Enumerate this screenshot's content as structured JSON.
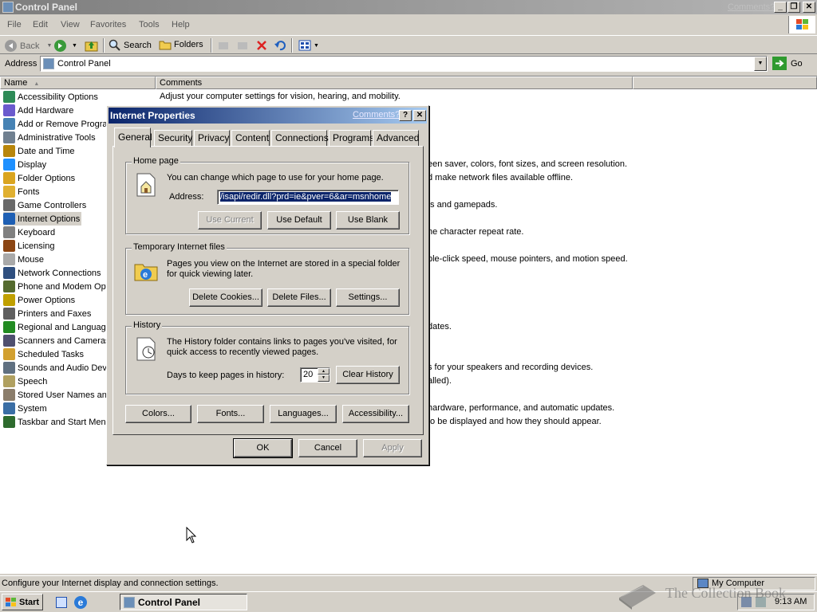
{
  "window": {
    "title": "Control Panel",
    "comments_link": "Comments?"
  },
  "menu": [
    "File",
    "Edit",
    "View",
    "Favorites",
    "Tools",
    "Help"
  ],
  "toolbar": {
    "back": "Back",
    "search": "Search",
    "folders": "Folders"
  },
  "address": {
    "label": "Address",
    "value": "Control Panel",
    "go": "Go"
  },
  "columns": {
    "name": "Name",
    "comments": "Comments"
  },
  "items": [
    {
      "name": "Accessibility Options",
      "comment": "Adjust your computer settings for vision, hearing, and mobility.",
      "color": "#2e8b57"
    },
    {
      "name": "Add Hardware",
      "comment": "",
      "color": "#6a5acd"
    },
    {
      "name": "Add or Remove Progra",
      "comment": "",
      "color": "#4682b4"
    },
    {
      "name": "Administrative Tools",
      "comment": "",
      "color": "#708090"
    },
    {
      "name": "Date and Time",
      "comment": "",
      "color": "#b8860b"
    },
    {
      "name": "Display",
      "comment": "een saver, colors, font sizes, and screen resolution.",
      "color": "#1e90ff"
    },
    {
      "name": "Folder Options",
      "comment": "d make network files available offline.",
      "color": "#daa520"
    },
    {
      "name": "Fonts",
      "comment": "",
      "color": "#e0b030"
    },
    {
      "name": "Game Controllers",
      "comment": "ts and gamepads.",
      "color": "#696969"
    },
    {
      "name": "Internet Options",
      "comment": "",
      "color": "#1e5fb4"
    },
    {
      "name": "Keyboard",
      "comment": "he character repeat rate.",
      "color": "#808080"
    },
    {
      "name": "Licensing",
      "comment": "",
      "color": "#8b4513"
    },
    {
      "name": "Mouse",
      "comment": "ble-click speed, mouse pointers, and motion speed.",
      "color": "#a9a9a9"
    },
    {
      "name": "Network Connections",
      "comment": "",
      "color": "#2f4f7f"
    },
    {
      "name": "Phone and Modem Opt",
      "comment": "",
      "color": "#556b2f"
    },
    {
      "name": "Power Options",
      "comment": "",
      "color": "#c0a000"
    },
    {
      "name": "Printers and Faxes",
      "comment": "",
      "color": "#5f5f5f"
    },
    {
      "name": "Regional and Language",
      "comment": "dates.",
      "color": "#228b22"
    },
    {
      "name": "Scanners and Cameras",
      "comment": "",
      "color": "#4f4f6f"
    },
    {
      "name": "Scheduled Tasks",
      "comment": "",
      "color": "#d2a030"
    },
    {
      "name": "Sounds and Audio Dev",
      "comment": "s for your speakers and recording devices.",
      "color": "#607080"
    },
    {
      "name": "Speech",
      "comment": "alled).",
      "color": "#b0a060"
    },
    {
      "name": "Stored User Names and",
      "comment": "",
      "color": "#8b7d6b"
    },
    {
      "name": "System",
      "comment": "hardware, performance, and automatic updates.",
      "color": "#3a6ea5"
    },
    {
      "name": "Taskbar and Start Men",
      "comment": "to be displayed and how they should appear.",
      "color": "#2e6b2e"
    }
  ],
  "status": {
    "text": "Configure your Internet display and connection settings.",
    "zone": "My Computer"
  },
  "taskbar": {
    "start": "Start",
    "task": "Control Panel",
    "clock": "9:13 AM"
  },
  "watermark": "The Collection Book",
  "dialog": {
    "title": "Internet Properties",
    "comments": "Comments?",
    "tabs": [
      "General",
      "Security",
      "Privacy",
      "Content",
      "Connections",
      "Programs",
      "Advanced"
    ],
    "homepage": {
      "label": "Home page",
      "text": "You can change which page to use for your home page.",
      "address_label": "Address:",
      "address_value": "/isapi/redir.dll?prd=ie&pver=6&ar=msnhome",
      "use_current": "Use Current",
      "use_default": "Use Default",
      "use_blank": "Use Blank"
    },
    "temp": {
      "label": "Temporary Internet files",
      "text1": "Pages you view on the Internet are stored in a special folder",
      "text2": "for quick viewing later.",
      "delete_cookies": "Delete Cookies...",
      "delete_files": "Delete Files...",
      "settings": "Settings..."
    },
    "history": {
      "label": "History",
      "text1": "The History folder contains links to pages you've visited, for",
      "text2": "quick access to recently viewed pages.",
      "days_label": "Days to keep pages in history:",
      "days": "20",
      "clear": "Clear History"
    },
    "bottom": {
      "colors": "Colors...",
      "fonts": "Fonts...",
      "languages": "Languages...",
      "accessibility": "Accessibility..."
    },
    "ok": "OK",
    "cancel": "Cancel",
    "apply": "Apply"
  }
}
